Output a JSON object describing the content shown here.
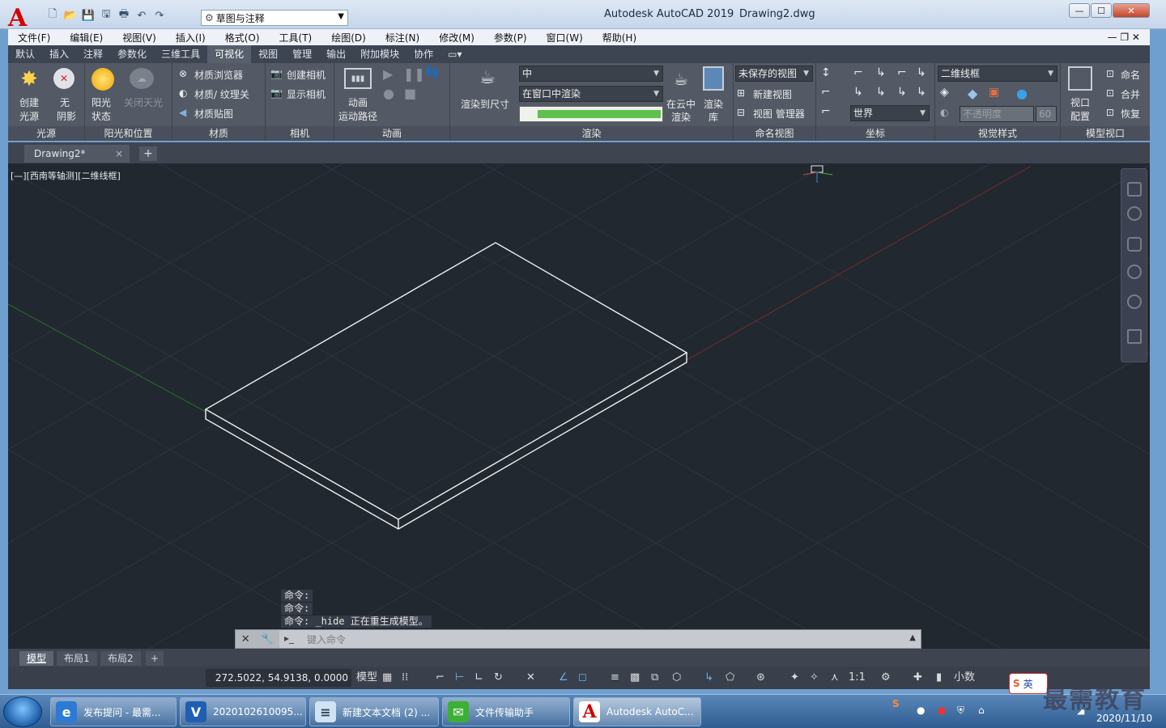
{
  "window": {
    "app_title": "Autodesk AutoCAD 2019",
    "doc_title": "Drawing2.dwg",
    "workspace": "草图与注释",
    "min": "—",
    "max": "☐",
    "close": "✕"
  },
  "menu": [
    "文件(F)",
    "编辑(E)",
    "视图(V)",
    "插入(I)",
    "格式(O)",
    "工具(T)",
    "绘图(D)",
    "标注(N)",
    "修改(M)",
    "参数(P)",
    "窗口(W)",
    "帮助(H)"
  ],
  "ribbon_tabs": [
    "默认",
    "插入",
    "注释",
    "参数化",
    "三维工具",
    "可视化",
    "视图",
    "管理",
    "输出",
    "附加模块",
    "协作"
  ],
  "active_tab": "可视化",
  "ribbon": {
    "lights": {
      "create_light": [
        "创建",
        "光源"
      ],
      "no_shadow": [
        "无",
        "阴影"
      ],
      "panel": "光源"
    },
    "sun": {
      "sun_status": [
        "阳光",
        "状态"
      ],
      "sky_off": "关闭天光",
      "panel": "阳光和位置"
    },
    "materials": {
      "browser": "材质浏览器",
      "texture": "材质/ 纹理关",
      "mapping": "材质贴图",
      "panel": "材质"
    },
    "camera": {
      "create": "创建相机",
      "show": "显示相机",
      "panel": "相机"
    },
    "animation": {
      "path": [
        "动画",
        "运动路径"
      ],
      "panel": "动画"
    },
    "render": {
      "render_size": "渲染到尺寸",
      "quality": "中",
      "target": "在窗口中渲染",
      "cloud": [
        "在云中",
        "渲染"
      ],
      "gallery": [
        "渲染",
        "库"
      ],
      "panel": "渲染"
    },
    "named_views": {
      "unsaved": "未保存的视图",
      "new": "新建视图",
      "manager": "视图 管理器",
      "panel": "命名视图"
    },
    "coordinates": {
      "ucs": "世界",
      "panel": "坐标"
    },
    "visual_styles": {
      "style": "二维线框",
      "opacity": "不透明度",
      "opacity_value": "60",
      "panel": "视觉样式"
    },
    "viewports": {
      "config": [
        "视口",
        "配置"
      ],
      "name": "命名",
      "join": "合并",
      "restore": "恢复",
      "panel": "模型视口"
    }
  },
  "document_tab": {
    "name": "Drawing2*",
    "close": "×",
    "add": "+"
  },
  "viewport": {
    "label": "[—][西南等轴测][二维线框]",
    "history": [
      "命令:",
      "命令:",
      "命令: _hide 正在重生成模型。"
    ],
    "command_placeholder": "键入命令"
  },
  "layout_tabs": [
    "模型",
    "布局1",
    "布局2"
  ],
  "status": {
    "coords": "272.5022, 54.9138, 0.0000",
    "model": "模型",
    "scale": "1:1",
    "units": "小数"
  },
  "taskbar": {
    "items": [
      {
        "label": "发布提问 - 最需...",
        "icon": "e"
      },
      {
        "label": "2020102610095...",
        "icon": "V"
      },
      {
        "label": "新建文本文档 (2) ...",
        "icon": "≡"
      },
      {
        "label": "文件传输助手",
        "icon": "✉"
      },
      {
        "label": "Autodesk AutoC...",
        "icon": "A"
      }
    ],
    "date": "2020/11/10",
    "ime": "英"
  },
  "watermark": "最需教育",
  "colors": {
    "viewport_bg": "#212830",
    "ribbon_bg": "#535a66",
    "x_axis": "#8a2a2a",
    "y_axis": "#2a6a2a"
  }
}
